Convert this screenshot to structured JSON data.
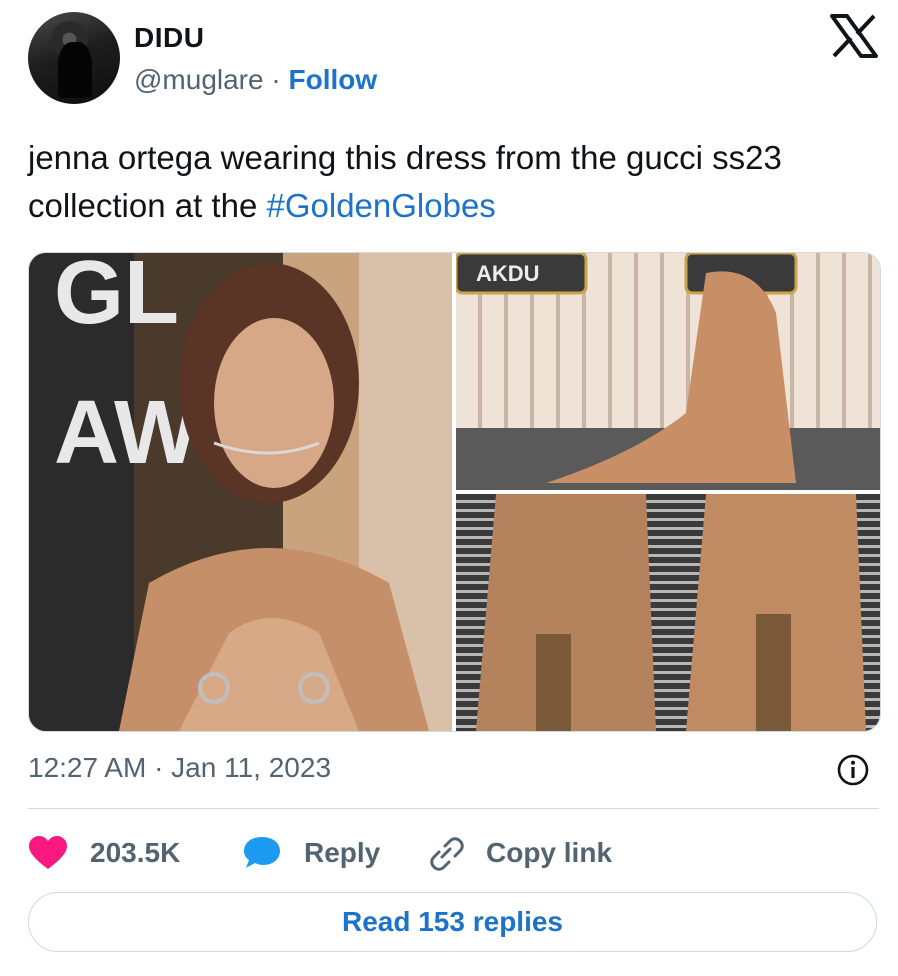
{
  "author": {
    "display_name": "DIDU",
    "handle": "@muglare",
    "separator": "·",
    "follow_label": "Follow"
  },
  "tweet": {
    "text": "jenna ortega wearing this dress from the gucci ss23 collection at the ",
    "hashtag": "#GoldenGlobes"
  },
  "media": {
    "photos": [
      {
        "description_icon": "photo"
      },
      {
        "description_icon": "photo"
      },
      {
        "description_icon": "photo"
      }
    ],
    "overlay_text": {
      "main": "GL AW",
      "top_sign": "AKDU"
    }
  },
  "meta": {
    "timestamp": "12:27 AM · Jan 11, 2023"
  },
  "actions": {
    "likes": "203.5K",
    "reply_label": "Reply",
    "copy_label": "Copy link"
  },
  "footer": {
    "read_replies_label": "Read 153 replies"
  },
  "colors": {
    "accent": "#1d73c9",
    "heart": "#f91880",
    "reply_bubble": "#1d9bf0",
    "secondary_text": "#536471",
    "border": "#cfd9de"
  },
  "icons": {
    "x_logo": "x-logo-icon",
    "info": "info-icon",
    "heart": "heart-icon",
    "reply": "speech-bubble-icon",
    "link": "link-icon"
  }
}
